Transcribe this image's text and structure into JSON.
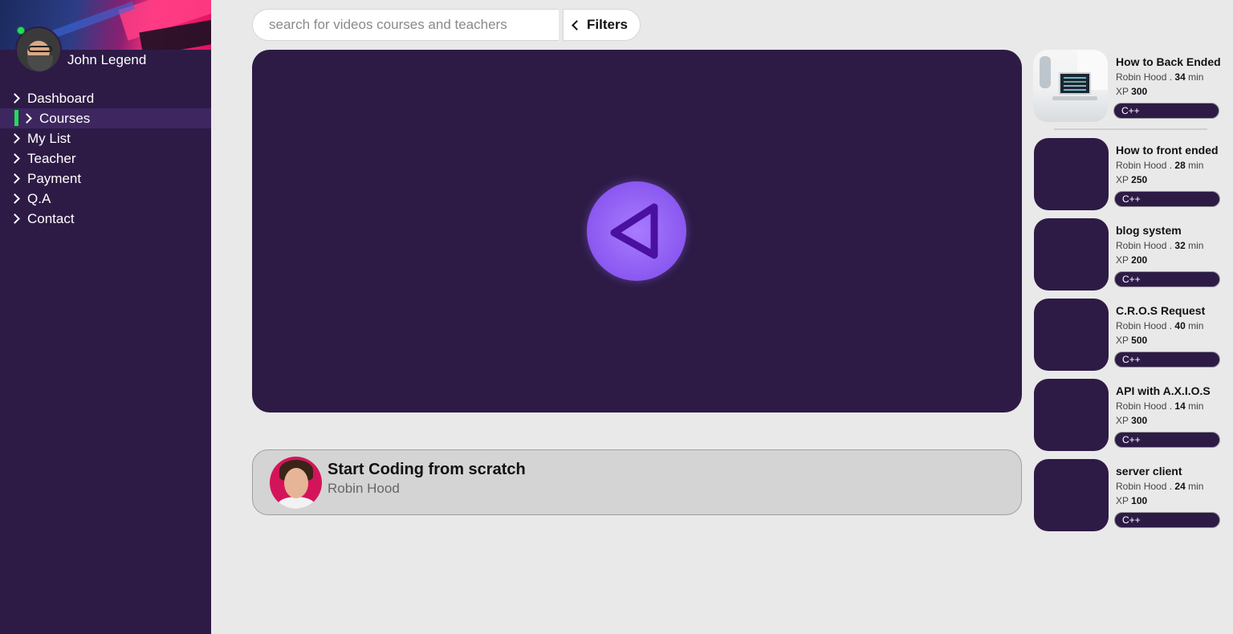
{
  "user": {
    "name": "John Legend",
    "status": "online"
  },
  "nav": {
    "items": [
      {
        "label": "Dashboard",
        "active": false
      },
      {
        "label": "Courses",
        "active": true
      },
      {
        "label": "My List",
        "active": false
      },
      {
        "label": "Teacher",
        "active": false
      },
      {
        "label": "Payment",
        "active": false
      },
      {
        "label": "Q.A",
        "active": false
      },
      {
        "label": "Contact",
        "active": false
      }
    ]
  },
  "search": {
    "placeholder": "search for videos courses and teachers",
    "value": ""
  },
  "filters": {
    "label": "Filters"
  },
  "player": {
    "button_icon": "play-icon"
  },
  "course": {
    "title": "Start Coding from scratch",
    "teacher": "Robin Hood"
  },
  "playlist": [
    {
      "title": "How to Back Ended",
      "author": "Robin Hood",
      "sep": ".",
      "duration": "34",
      "unit": "min",
      "xp_label": "XP",
      "xp": "300",
      "tag": "C++"
    },
    {
      "title": "How to front ended",
      "author": "Robin Hood",
      "sep": ".",
      "duration": "28",
      "unit": "min",
      "xp_label": "XP",
      "xp": "250",
      "tag": "C++"
    },
    {
      "title": "blog system",
      "author": "Robin Hood",
      "sep": ".",
      "duration": "32",
      "unit": "min",
      "xp_label": "XP",
      "xp": "200",
      "tag": "C++"
    },
    {
      "title": "C.R.O.S Request",
      "author": "Robin Hood",
      "sep": ".",
      "duration": "40",
      "unit": "min",
      "xp_label": "XP",
      "xp": "500",
      "tag": "C++"
    },
    {
      "title": "API with A.X.I.O.S",
      "author": "Robin Hood",
      "sep": ".",
      "duration": "14",
      "unit": "min",
      "xp_label": "XP",
      "xp": "300",
      "tag": "C++"
    },
    {
      "title": "server client",
      "author": "Robin Hood",
      "sep": ".",
      "duration": "24",
      "unit": "min",
      "xp_label": "XP",
      "xp": "100",
      "tag": "C++"
    }
  ],
  "colors": {
    "sidebar": "#2d1b46",
    "accent_green": "#22dd55",
    "play_purple": "#8a58f0",
    "background": "#e9e9e9"
  }
}
